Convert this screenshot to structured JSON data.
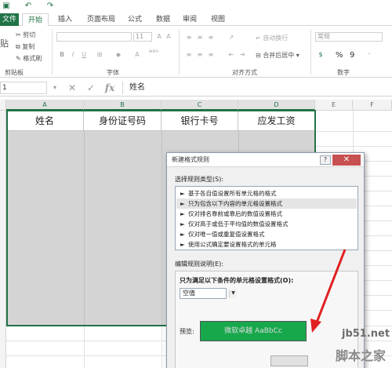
{
  "qat": {
    "save_icon": "save-icon",
    "undo_icon": "undo-icon",
    "redo_icon": "redo-icon"
  },
  "tabs": {
    "file": "文件",
    "home": "开始",
    "insert": "插入",
    "page_layout": "页面布局",
    "formulas": "公式",
    "data": "数据",
    "review": "审阅",
    "view": "视图"
  },
  "ribbon": {
    "paste": "贴",
    "cut": "剪切",
    "copy": "复制",
    "format_painter": "格式刷",
    "clipboard_label": "剪贴板",
    "font_size": "11",
    "bold": "B",
    "italic": "I",
    "underline": "U",
    "font_label": "字体",
    "wen": "wén",
    "wrap_text": "自动换行",
    "merge_center": "合并后居中",
    "alignment_label": "对齐方式",
    "number_format": "常规",
    "percent": "%",
    "comma": "9",
    "number_label": "数字"
  },
  "formula_bar": {
    "name_box": "1",
    "formula": "姓名"
  },
  "columns": [
    "A",
    "B",
    "C",
    "D",
    "E",
    "F"
  ],
  "headers": [
    "姓名",
    "身份证号码",
    "银行卡号",
    "应发工资"
  ],
  "dialog": {
    "title": "新建格式规则",
    "help": "?",
    "close": "✕",
    "select_rule_type": "选择规则类型(S):",
    "rules": [
      "基于各自值设置所有单元格的格式",
      "只为包含以下内容的单元格设置格式",
      "仅对排名靠前或靠后的数值设置格式",
      "仅对高于或低于平均值的数值设置格式",
      "仅对唯一值或重复值设置格式",
      "使用公式确定要设置格式的单元格"
    ],
    "selected_rule_index": 1,
    "edit_rule_desc": "编辑规则说明(E):",
    "only_format_label": "只为满足以下条件的单元格设置格式(O):",
    "condition": "空值",
    "preview_label": "预览:",
    "preview_text": "微软卓越  AaBbCc"
  },
  "watermark": {
    "url": "jb51.net",
    "name": "脚本之家"
  },
  "colors": {
    "excel_green": "#217346",
    "preview_fill": "#17a84c",
    "arrow": "#e02020"
  }
}
